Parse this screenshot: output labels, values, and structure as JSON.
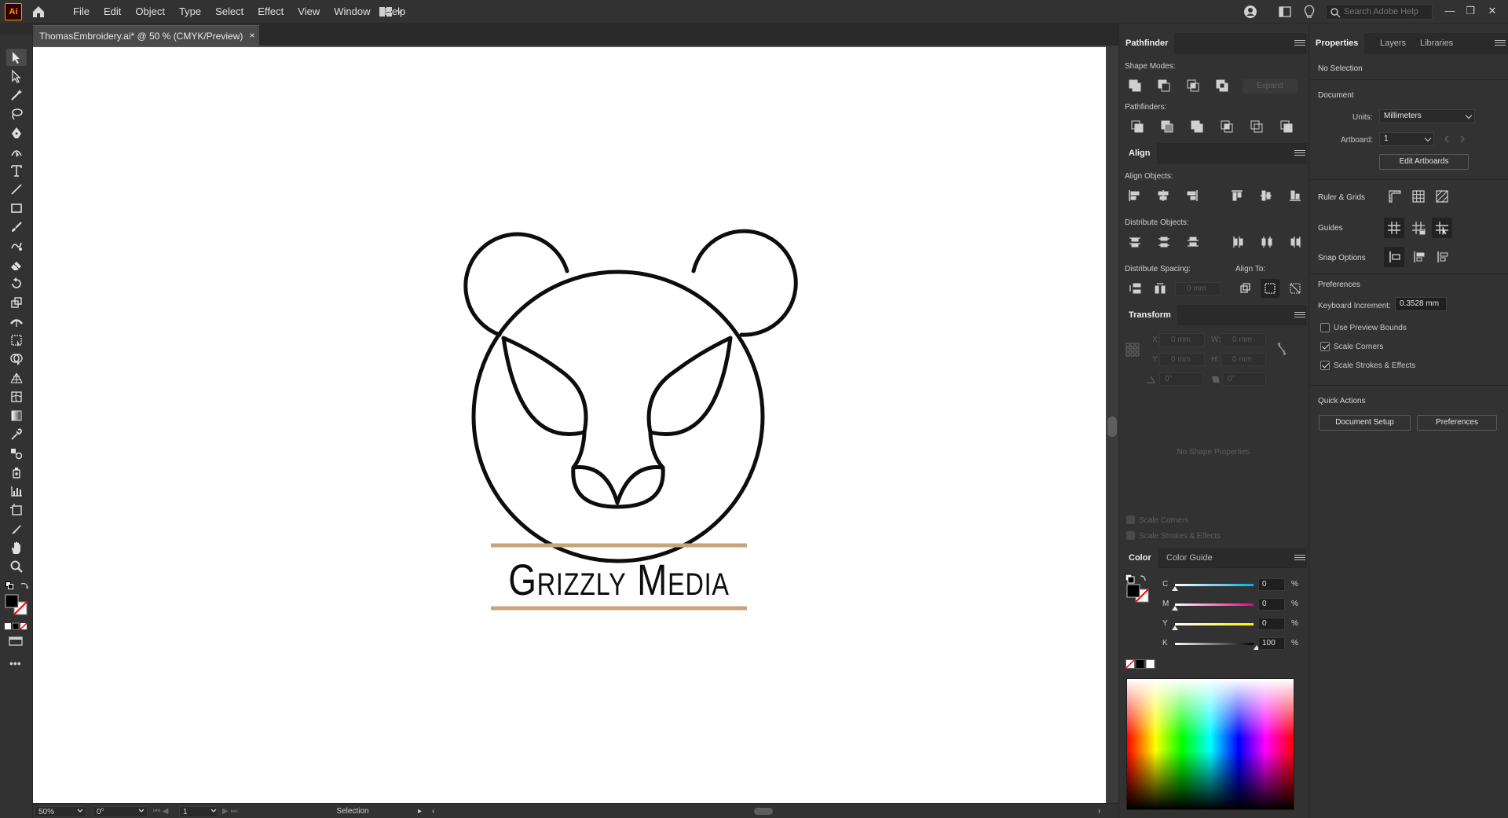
{
  "app": {
    "logo": "Ai"
  },
  "menu": [
    "File",
    "Edit",
    "Object",
    "Type",
    "Select",
    "Effect",
    "View",
    "Window",
    "Help"
  ],
  "search": {
    "placeholder": "Search Adobe Help"
  },
  "document": {
    "tab_title": "ThomasEmbroidery.ai* @ 50 % (CMYK/Preview)",
    "close": "×"
  },
  "artwork": {
    "logo_text": "Grizzly Media",
    "accent_color": "#c8a47a",
    "stroke_color": "#0d0d0d"
  },
  "status": {
    "zoom": "50%",
    "rotation": "0°",
    "artboard": "1",
    "tool": "Selection"
  },
  "pathfinder": {
    "title": "Pathfinder",
    "shape_modes_label": "Shape Modes:",
    "expand_label": "Expand",
    "pathfinders_label": "Pathfinders:"
  },
  "align": {
    "title": "Align",
    "align_objects_label": "Align Objects:",
    "distribute_objects_label": "Distribute Objects:",
    "distribute_spacing_label": "Distribute Spacing:",
    "align_to_label": "Align To:",
    "spacing_value": "0 mm"
  },
  "transform": {
    "title": "Transform",
    "x_label": "X:",
    "x_value": "0 mm",
    "y_label": "Y:",
    "y_value": "0 mm",
    "w_label": "W:",
    "w_value": "0 mm",
    "h_label": "H:",
    "h_value": "0 mm",
    "angle_value": "0°",
    "shear_value": "0°",
    "no_shape_props": "No Shape Properties",
    "scale_corners": "Scale Corners",
    "scale_strokes": "Scale Strokes & Effects"
  },
  "color": {
    "tab_color": "Color",
    "tab_guide": "Color Guide",
    "c_label": "C",
    "c_value": "0",
    "m_label": "M",
    "m_value": "0",
    "y_label": "Y",
    "y_value": "0",
    "k_label": "K",
    "k_value": "100",
    "pct": "%"
  },
  "properties": {
    "tabs": [
      "Properties",
      "Layers",
      "Libraries"
    ],
    "no_selection": "No Selection",
    "document_label": "Document",
    "units_label": "Units:",
    "units_value": "Millimeters",
    "artboard_label": "Artboard:",
    "artboard_value": "1",
    "edit_artboards": "Edit Artboards",
    "ruler_grids": "Ruler & Grids",
    "guides": "Guides",
    "snap_options": "Snap Options",
    "preferences_label": "Preferences",
    "keyboard_increment_label": "Keyboard Increment:",
    "keyboard_increment_value": "0.3528 mm",
    "use_preview_bounds": "Use Preview Bounds",
    "scale_corners": "Scale Corners",
    "scale_strokes": "Scale Strokes & Effects",
    "quick_actions": "Quick Actions",
    "document_setup": "Document Setup",
    "preferences_btn": "Preferences"
  }
}
